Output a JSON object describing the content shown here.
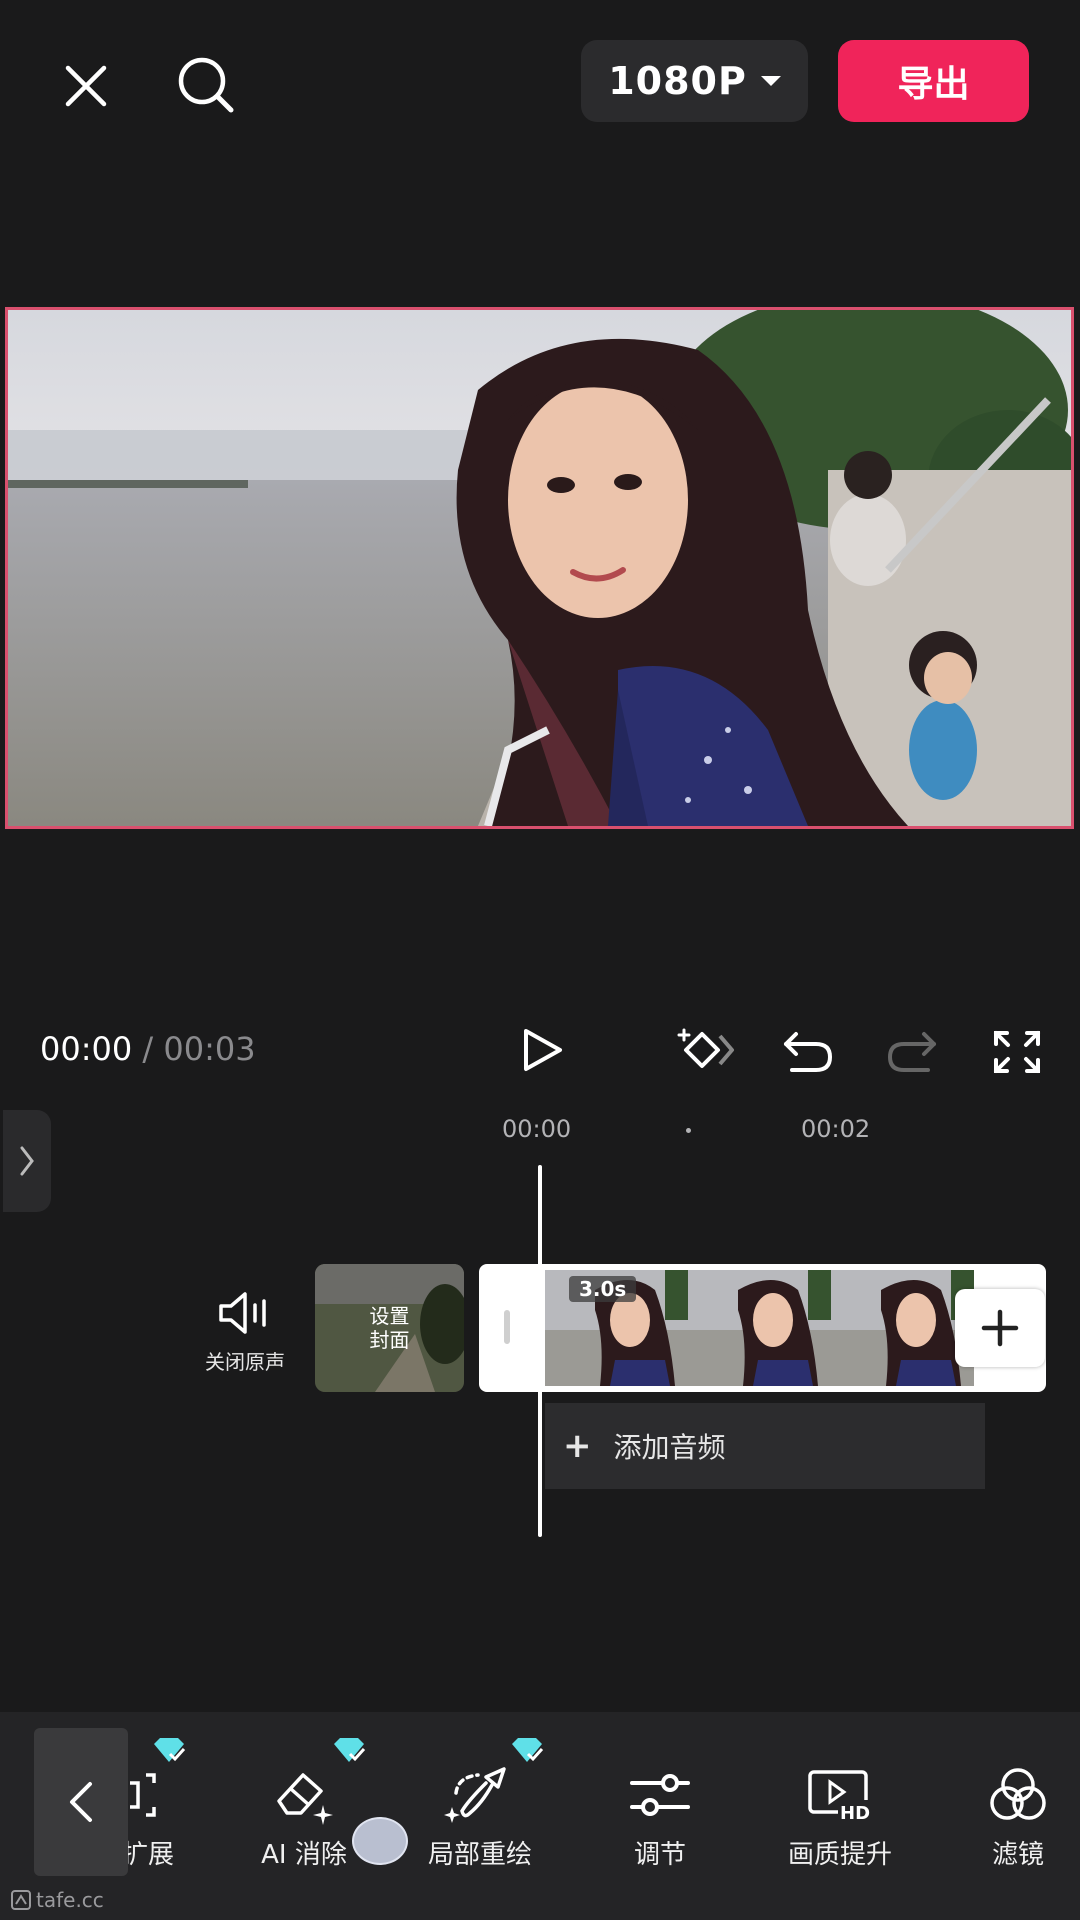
{
  "header": {
    "close_icon": "close-icon",
    "search_icon": "search-icon",
    "resolution": "1080P",
    "export_label": "导出"
  },
  "colors": {
    "accent": "#f0245a",
    "preview_border": "#d9506e",
    "background": "#1a1a1b"
  },
  "playback": {
    "current_time": "00:00",
    "separator": " / ",
    "total_time": "00:03"
  },
  "timeline": {
    "ruler": [
      "00:00",
      "00:02"
    ],
    "mute_label": "关闭原声",
    "cover_label": "设置\n封面",
    "clip_duration": "3.0s",
    "add_audio_label": "添加音频"
  },
  "toolbar": {
    "items": [
      {
        "label": "扩展",
        "icon": "expand-icon",
        "premium": true
      },
      {
        "label": "AI 消除",
        "icon": "eraser-icon",
        "premium": true
      },
      {
        "label": "局部重绘",
        "icon": "brush-icon",
        "premium": true
      },
      {
        "label": "调节",
        "icon": "sliders-icon",
        "premium": false
      },
      {
        "label": "画质提升",
        "icon": "hd-icon",
        "premium": false
      },
      {
        "label": "滤镜",
        "icon": "filter-icon",
        "premium": false
      }
    ]
  },
  "watermark": "tafe.cc"
}
